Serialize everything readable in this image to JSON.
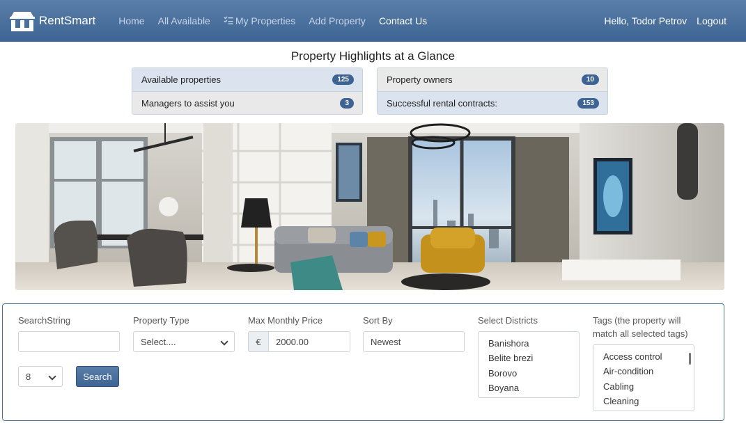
{
  "navbar": {
    "brand": "RentSmart",
    "links": [
      "Home",
      "All Available",
      "My Properties",
      "Add Property",
      "Contact Us"
    ],
    "greeting": "Hello, Todor Petrov",
    "logout": "Logout"
  },
  "highlights": {
    "title": "Property Highlights at a Glance",
    "left": [
      {
        "label": "Available properties",
        "count": "125"
      },
      {
        "label": "Managers to assist you",
        "count": "3"
      }
    ],
    "right": [
      {
        "label": "Property owners",
        "count": "10"
      },
      {
        "label": "Successful rental contracts:",
        "count": "153"
      }
    ]
  },
  "search": {
    "search_string_label": "SearchString",
    "search_string_value": "",
    "property_type_label": "Property Type",
    "property_type_value": "Select....",
    "max_price_label": "Max Monthly Price",
    "currency_symbol": "€",
    "max_price_value": "2000.00",
    "sort_by_label": "Sort By",
    "sort_by_value": "Newest",
    "districts_label": "Select Districts",
    "districts": [
      "Banishora",
      "Belite brezi",
      "Borovo",
      "Boyana"
    ],
    "tags_label_line1": "Tags (the property will",
    "tags_label_line2": "match all selected tags)",
    "tags": [
      "Access control",
      "Air-condition",
      "Cabling",
      "Cleaning"
    ],
    "per_page_value": "8",
    "search_button": "Search"
  }
}
